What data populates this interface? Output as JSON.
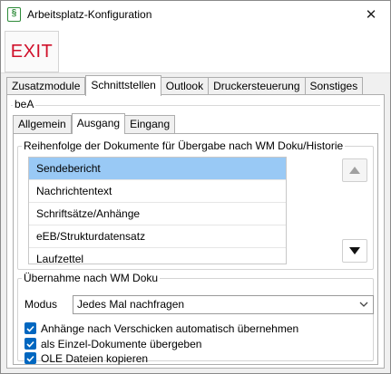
{
  "window": {
    "title": "Arbeitsplatz-Konfiguration",
    "app_icon_glyph": "§",
    "close_glyph": "✕"
  },
  "toolbar": {
    "exit_label": "EXIT",
    "exit_color": "#d0102a"
  },
  "top_tabs": [
    {
      "label": "Zusatzmodule",
      "active": false
    },
    {
      "label": "Schnittstellen",
      "active": true
    },
    {
      "label": "Outlook",
      "active": false
    },
    {
      "label": "Druckersteuerung",
      "active": false
    },
    {
      "label": "Sonstiges",
      "active": false
    }
  ],
  "bea": {
    "group_label": "beA",
    "inner_tabs": [
      {
        "label": "Allgemein",
        "active": false
      },
      {
        "label": "Ausgang",
        "active": true
      },
      {
        "label": "Eingang",
        "active": false
      }
    ],
    "order_group": {
      "legend": "Reihenfolge der Dokumente für Übergabe nach WM Doku/Historie",
      "items": [
        {
          "label": "Sendebericht",
          "selected": true
        },
        {
          "label": "Nachrichtentext",
          "selected": false
        },
        {
          "label": "Schriftsätze/Anhänge",
          "selected": false
        },
        {
          "label": "eEB/Strukturdatensatz",
          "selected": false
        },
        {
          "label": "Laufzettel",
          "selected": false
        }
      ],
      "up_icon": "arrow-up-icon",
      "down_icon": "arrow-down-icon"
    },
    "import_group": {
      "legend": "Übernahme nach WM Doku",
      "mode_label": "Modus",
      "mode_value": "Jedes Mal nachfragen",
      "checkboxes": [
        {
          "label": "Anhänge nach Verschicken automatisch übernehmen",
          "checked": true
        },
        {
          "label": "als Einzel-Dokumente übergeben",
          "checked": true
        },
        {
          "label": "OLE Dateien kopieren",
          "checked": true
        }
      ]
    }
  },
  "colors": {
    "accent": "#0067c0",
    "selection": "#99c9f5"
  }
}
